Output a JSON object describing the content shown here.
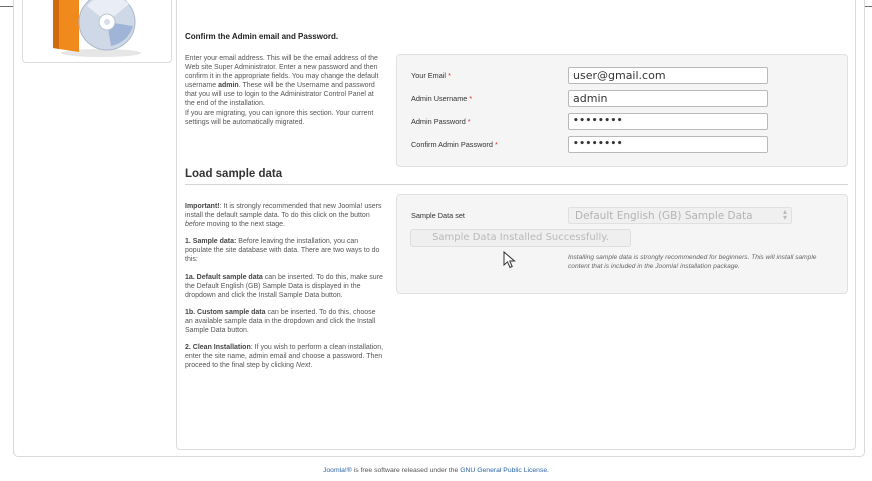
{
  "admin_section": {
    "heading": "Confirm the Admin email and Password.",
    "description": {
      "p1": "Enter your email address. This will be the email address of the Web site Super Administrator. Enter a new password and then confirm it in the appropriate fields. You may change the default username ",
      "p1_bold": "admin",
      "p1_end": ". These will be the Username and password that you will use to login to the Administrator Control Panel at the end of the installation.",
      "p2": "If you are migrating, you can ignore this section. Your current settings will be automatically migrated."
    },
    "fields": {
      "email_label": "Your Email",
      "email_value": "user@gmail.com",
      "username_label": "Admin Username",
      "username_value": "admin",
      "password_label": "Admin Password",
      "password_value": "••••••••",
      "confirm_label": "Confirm Admin Password",
      "confirm_value": "••••••••",
      "required_mark": "*"
    }
  },
  "sample_section": {
    "title": "Load sample data",
    "important_bold": "Important!",
    "important_text": ": It is strongly recommended that new Joomla! users install the default sample data. To do this click on the button ",
    "important_italic": "before",
    "important_end": " moving to the next stage.",
    "item1_bold": "1. Sample data:",
    "item1_text": " Before leaving the installation, you can populate the site database with data. There are two ways to do this:",
    "item1a_bold": "1a. Default sample data",
    "item1a_text": " can be inserted. To do this, make sure the Default English (GB) Sample Data is displayed in the dropdown and click the Install Sample Data button.",
    "item1b_bold": "1b. Custom sample data",
    "item1b_text": " can be inserted. To do this, choose an available sample data in the dropdown and click the Install Sample Data button.",
    "item2_bold": "2. Clean Installation",
    "item2_text": ": If you wish to perform a clean installation, enter the site name, admin email and choose a password. Then proceed to the final step by clicking ",
    "item2_italic": "Next",
    "item2_end": ".",
    "set_label": "Sample Data set",
    "set_value": "Default English (GB) Sample Data",
    "installed_button": "Sample Data Installed Successfully.",
    "note": "Installing sample data is strongly recommended for beginners. This will install sample content that is included in the Joomla! installation package."
  },
  "footer": {
    "brand": "Joomla!®",
    "text": " is free software released under the ",
    "license_link": "GNU General Public License",
    "end": "."
  },
  "icons": {
    "logo": "install-box-cd-icon",
    "cursor": "mouse-pointer-icon"
  },
  "colors": {
    "link": "#2a64a8",
    "required": "#cc3333",
    "box_orange": "#f08a1c"
  }
}
